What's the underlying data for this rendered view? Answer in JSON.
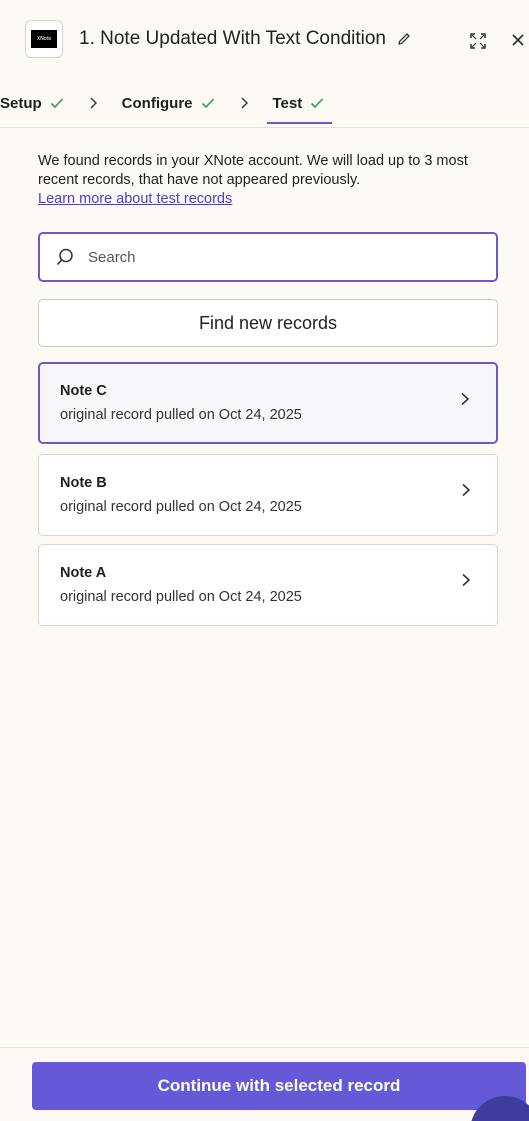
{
  "header": {
    "app_logo_text": "XNote",
    "title": "1. Note Updated With Text Condition",
    "icons": [
      "pencil-icon",
      "expand-icon",
      "close-icon"
    ]
  },
  "tabs": [
    {
      "label": "Setup",
      "completed": true,
      "active": false
    },
    {
      "label": "Configure",
      "completed": true,
      "active": false
    },
    {
      "label": "Test",
      "completed": true,
      "active": true
    }
  ],
  "intro": {
    "text": "We found records in your XNote account. We will load up to 3 most recent records, that have not appeared previously.",
    "link": "Learn more about test records"
  },
  "search": {
    "placeholder": "Search",
    "value": ""
  },
  "find_button": {
    "label": "Find new records"
  },
  "records": [
    {
      "title": "Note C",
      "subtitle": "original record pulled on Oct 24, 2025",
      "selected": true
    },
    {
      "title": "Note B",
      "subtitle": "original record pulled on Oct 24, 2025",
      "selected": false
    },
    {
      "title": "Note A",
      "subtitle": "original record pulled on Oct 24, 2025",
      "selected": false
    }
  ],
  "continue_button": {
    "label": "Continue with selected record"
  },
  "colors": {
    "accent": "#6a5acd",
    "button": "#6559d8",
    "check": "#2f9e55",
    "background": "#fdfaf6"
  }
}
